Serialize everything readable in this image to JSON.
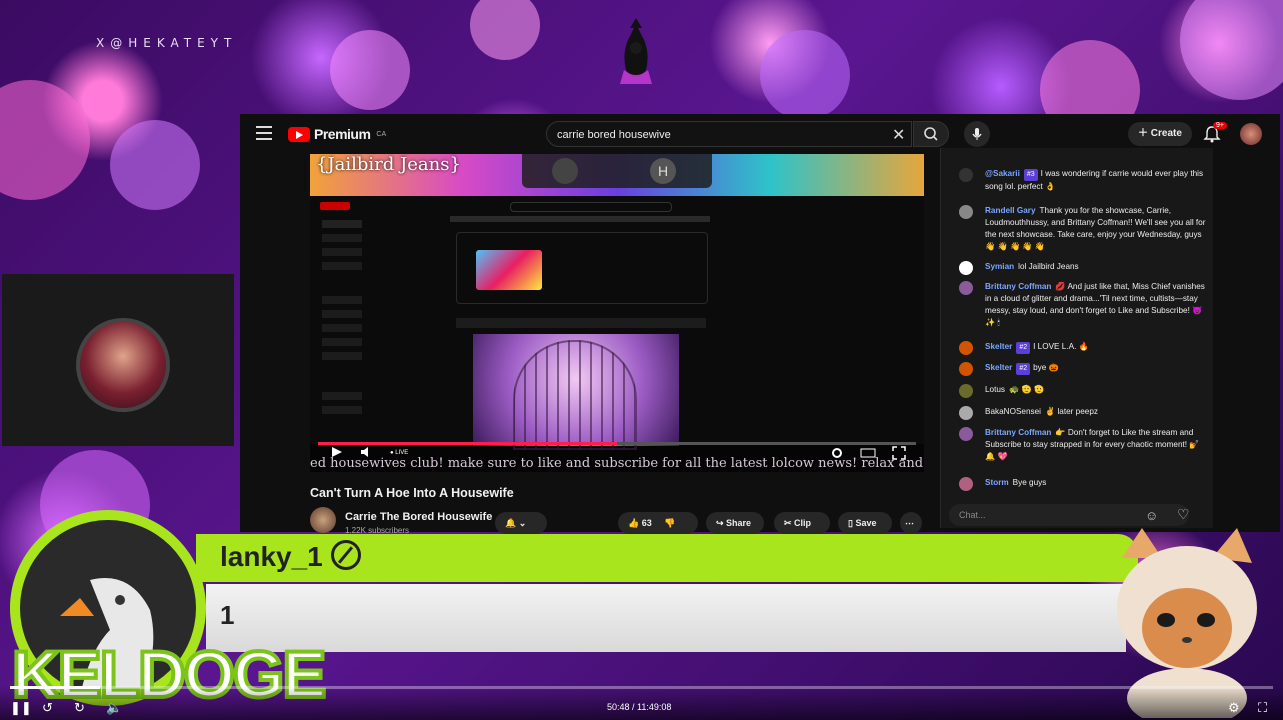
{
  "overlay": {
    "handle": "X@HEKATEYT",
    "streamer_logo": "keldoge",
    "colors": {
      "accent_green": "#a8e51d",
      "purple_bg": "#5a1690",
      "yt_red": "#ff0000"
    }
  },
  "youtube": {
    "logo_text": "Premium",
    "region": "CA",
    "search_value": "carrie bored housewive",
    "create_label": "Create",
    "notif_badge": "9+",
    "banner_text": "{Jailbird Jeans}",
    "ticker_text": "ed housewives club! make sure to like and subscribe for all the latest lolcow news! relax and g",
    "live_label": "LIVE",
    "video_title": "Can't Turn A Hoe Into A Housewife",
    "channel_name": "Carrie The Bored Housewife",
    "subscribers": "1.22K subscribers",
    "like_count": "63",
    "share_label": "Share",
    "clip_label": "Clip",
    "save_label": "Save",
    "chat_placeholder": "Chat...",
    "chat": [
      {
        "author": "@Sakarii",
        "badge": "#3",
        "text": "I was wondering if carrie would ever play this song lol. perfect 👌"
      },
      {
        "author": "Randell Gary",
        "badge": "",
        "text": "Thank you for the showcase, Carrie, Loudmouthhussy, and Brittany Coffman!! We'll see you all for the next showcase. Take care, enjoy your Wednesday, guys 👋 👋 👋 👋 👋"
      },
      {
        "author": "Symian",
        "badge": "",
        "text": "lol Jailbird Jeans"
      },
      {
        "author": "Brittany Coffman",
        "badge": "",
        "text": "💋 And just like that, Miss Chief vanishes in a cloud of glitter and drama...'Til next time, cultists—stay messy, stay loud, and don't forget to Like and Subscribe! 😈 ✨ 🕯"
      },
      {
        "author": "Skelter",
        "badge": "#2",
        "text": "I LOVE L.A. 🔥"
      },
      {
        "author": "Skelter",
        "badge": "#2",
        "text": "bye 🎃"
      },
      {
        "author": "Lotus",
        "badge": "",
        "text": "🐢 🫡 🫡"
      },
      {
        "author": "BakaNOSensei",
        "badge": "",
        "text": "✌ later peepz"
      },
      {
        "author": "Brittany Coffman",
        "badge": "",
        "text": "👉 Don't forget to Like the stream and Subscribe to stay strapped in for every chaotic moment! 💅 🔔 💖"
      },
      {
        "author": "Storm",
        "badge": "",
        "text": "Bye guys"
      }
    ]
  },
  "alert": {
    "username": "lanky_1",
    "message": "1",
    "brand": "KELDOGE"
  },
  "player": {
    "time": "50:48 / 11:49:08",
    "progress_fraction": 0.0716
  }
}
